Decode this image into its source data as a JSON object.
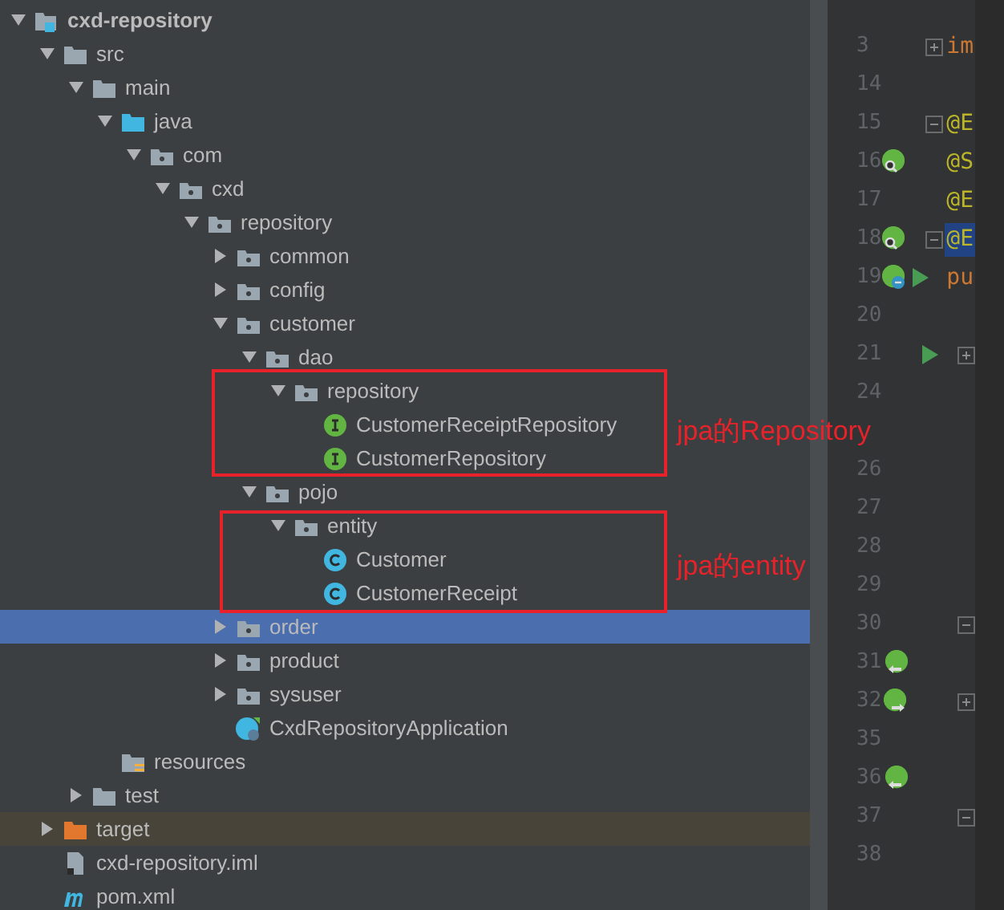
{
  "project_tree": [
    {
      "label": "cxd-repository",
      "kind": "module",
      "expanded": true,
      "selected": false,
      "children": [
        {
          "label": "src",
          "kind": "folder",
          "expanded": true,
          "selected": false,
          "children": [
            {
              "label": "main",
              "kind": "folder",
              "expanded": true,
              "selected": false,
              "children": [
                {
                  "label": "java",
                  "kind": "source-folder",
                  "expanded": true,
                  "selected": false,
                  "children": [
                    {
                      "label": "com",
                      "kind": "package",
                      "expanded": true,
                      "selected": false,
                      "children": [
                        {
                          "label": "cxd",
                          "kind": "package",
                          "expanded": true,
                          "selected": false,
                          "children": [
                            {
                              "label": "repository",
                              "kind": "package",
                              "expanded": true,
                              "selected": false,
                              "children": [
                                {
                                  "label": "common",
                                  "kind": "package",
                                  "expanded": false,
                                  "selected": false
                                },
                                {
                                  "label": "config",
                                  "kind": "package",
                                  "expanded": false,
                                  "selected": false
                                },
                                {
                                  "label": "customer",
                                  "kind": "package",
                                  "expanded": true,
                                  "selected": false,
                                  "children": [
                                    {
                                      "label": "dao",
                                      "kind": "package",
                                      "expanded": true,
                                      "selected": false,
                                      "children": [
                                        {
                                          "label": "repository",
                                          "kind": "package",
                                          "expanded": true,
                                          "selected": false,
                                          "children": [
                                            {
                                              "label": "CustomerReceiptRepository",
                                              "kind": "interface",
                                              "selected": false
                                            },
                                            {
                                              "label": "CustomerRepository",
                                              "kind": "interface",
                                              "selected": false
                                            }
                                          ]
                                        }
                                      ]
                                    },
                                    {
                                      "label": "pojo",
                                      "kind": "package",
                                      "expanded": true,
                                      "selected": false,
                                      "children": [
                                        {
                                          "label": "entity",
                                          "kind": "package",
                                          "expanded": true,
                                          "selected": false,
                                          "children": [
                                            {
                                              "label": "Customer",
                                              "kind": "class",
                                              "selected": false
                                            },
                                            {
                                              "label": "CustomerReceipt",
                                              "kind": "class",
                                              "selected": false
                                            }
                                          ]
                                        }
                                      ]
                                    }
                                  ]
                                },
                                {
                                  "label": "order",
                                  "kind": "package",
                                  "expanded": false,
                                  "selected": true
                                },
                                {
                                  "label": "product",
                                  "kind": "package",
                                  "expanded": false,
                                  "selected": false
                                },
                                {
                                  "label": "sysuser",
                                  "kind": "package",
                                  "expanded": false,
                                  "selected": false
                                },
                                {
                                  "label": "CxdRepositoryApplication",
                                  "kind": "spring-class",
                                  "selected": false
                                }
                              ]
                            }
                          ]
                        }
                      ]
                    }
                  ]
                },
                {
                  "label": "resources",
                  "kind": "resources-folder",
                  "selected": false
                }
              ]
            },
            {
              "label": "test",
              "kind": "folder",
              "expanded": false,
              "selected": false
            }
          ]
        },
        {
          "label": "target",
          "kind": "excluded-folder",
          "expanded": false,
          "selected": false
        },
        {
          "label": "cxd-repository.iml",
          "kind": "iml-file",
          "selected": false
        },
        {
          "label": "pom.xml",
          "kind": "maven-file",
          "selected": false
        }
      ]
    }
  ],
  "annotations": [
    {
      "text": "jpa的Repository"
    },
    {
      "text": "jpa的entity"
    }
  ],
  "gutter_top": [
    {
      "number": "3",
      "folded": true,
      "code": {
        "text": "im",
        "kind": "keyword",
        "highlighted": false
      }
    },
    {
      "number": "14"
    },
    {
      "number": "15",
      "folded": false,
      "code": {
        "text": "@E",
        "kind": "annotation",
        "highlighted": false
      }
    },
    {
      "number": "16",
      "marker": {
        "kind": "bean-search"
      },
      "code": {
        "text": "@S",
        "kind": "annotation",
        "highlighted": false
      }
    },
    {
      "number": "17",
      "code": {
        "text": "@E",
        "kind": "annotation",
        "highlighted": false
      }
    },
    {
      "number": "18",
      "marker": {
        "kind": "bean-search"
      },
      "folded": false,
      "code": {
        "text": "@E",
        "kind": "annotation",
        "highlighted": true
      }
    },
    {
      "number": "19",
      "marker": {
        "kind": "bean-run"
      },
      "code": {
        "text": "pu",
        "kind": "keyword",
        "highlighted": false
      }
    },
    {
      "number": "20"
    },
    {
      "number": "21",
      "marker": {
        "kind": "run"
      },
      "folded": true
    },
    {
      "number": "24"
    }
  ],
  "gutter_bottom": [
    {
      "number": "26"
    },
    {
      "number": "27"
    },
    {
      "number": "28"
    },
    {
      "number": "29"
    },
    {
      "number": "30",
      "folded": false
    },
    {
      "number": "31",
      "marker": {
        "kind": "bean-in"
      }
    },
    {
      "number": "32",
      "marker": {
        "kind": "bean-out"
      },
      "folded": true
    },
    {
      "number": "35"
    },
    {
      "number": "36",
      "marker": {
        "kind": "bean-in"
      }
    },
    {
      "number": "37",
      "folded": false
    },
    {
      "number": "38"
    }
  ]
}
